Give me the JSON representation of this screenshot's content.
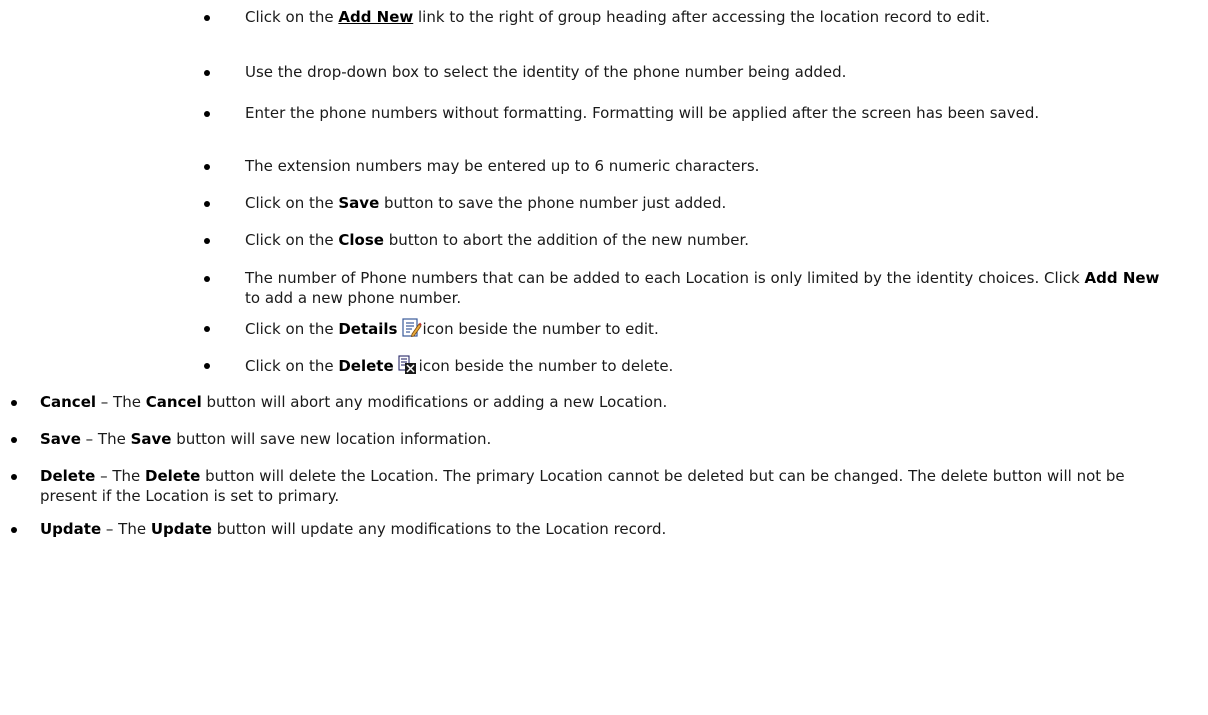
{
  "sub_bullets": [
    {
      "pre": "Click on the ",
      "bold": "Add New",
      "post": " link to the right of group heading after accessing the location record to edit."
    },
    {
      "text": "Use the drop-down box to select the identity of the phone number being added."
    },
    {
      "text": "Enter the phone numbers without formatting. Formatting will be applied after the screen has been saved."
    },
    {
      "text": "The extension numbers may be entered up to 6 numeric characters."
    },
    {
      "pre": "Click on the ",
      "bold": "Save",
      "post": " button to save the phone number just added."
    },
    {
      "pre": "Click on the ",
      "bold": "Close",
      "post": " button to abort the addition of the new number."
    },
    {
      "pre": "The number of Phone numbers that can be added to each Location is only limited by the identity choices. Click ",
      "bold": "Add New",
      "post": " to add a new phone number."
    },
    {
      "pre": "Click on the ",
      "bold": "Details",
      "icon": "details-edit-icon",
      "post": "icon beside the number to edit."
    },
    {
      "pre": "Click on the ",
      "bold": "Delete",
      "icon": "delete-row-icon",
      "post": "icon beside the number to delete."
    }
  ],
  "main_bullets": [
    {
      "term": "Cancel",
      "dash": " – The ",
      "bold2": "Cancel",
      "post": " button will abort any modifications or adding a new Location."
    },
    {
      "term": "Save",
      "dash": " – The ",
      "bold2": "Save",
      "post": " button will save new location information."
    },
    {
      "term": "Delete",
      "dash": " – The ",
      "bold2": "Delete",
      "post": " button will delete the Location. The primary Location cannot be deleted but can be changed. The delete button will not be present if the Location is set to primary."
    },
    {
      "term": "Update",
      "dash": " – The ",
      "bold2": "Update",
      "post": " button will update any modifications to the Location record."
    }
  ]
}
